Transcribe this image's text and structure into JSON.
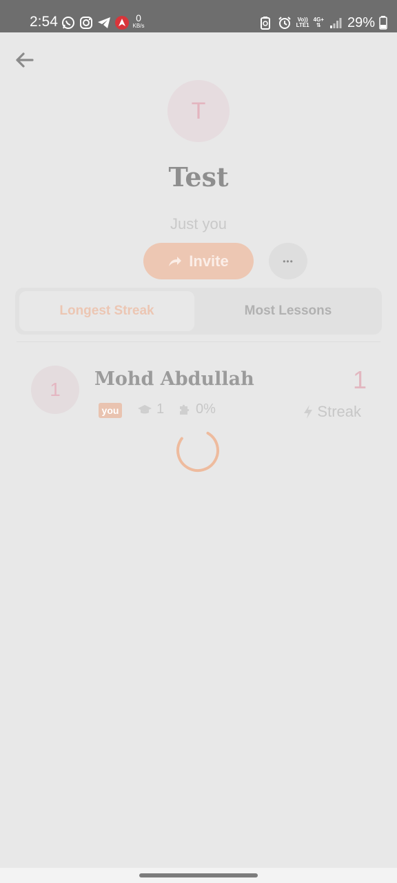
{
  "status_bar": {
    "time": "2:54",
    "net_speed_value": "0",
    "net_speed_unit": "KB/s",
    "volte_label_top": "Vo))",
    "volte_label_bottom": "LTE1",
    "signal_label_top": "4G+",
    "battery_percent": "29%",
    "left_icons": [
      "whatsapp-icon",
      "instagram-icon",
      "telegram-icon",
      "app-red-icon"
    ],
    "right_icons": [
      "recycle-icon",
      "alarm-icon",
      "signal-icon",
      "battery-icon"
    ]
  },
  "header": {
    "back_icon": "arrow-left-icon",
    "avatar_initial": "T",
    "group_name": "Test",
    "subtitle": "Just you",
    "invite_label": "Invite",
    "more_label": "•••"
  },
  "tabs": [
    {
      "label": "Longest Streak",
      "active": true
    },
    {
      "label": "Most Lessons",
      "active": false
    }
  ],
  "leaderboard": [
    {
      "rank": "1",
      "name": "Mohd Abdullah",
      "badge": "you",
      "lessons": "1",
      "progress": "0%",
      "score": "1",
      "metric_label": "Streak"
    }
  ],
  "colors": {
    "accent": "#edc7b3",
    "pink": "#e3b5bf",
    "background": "#e8e8e8",
    "status_bar": "#6e6e6e"
  }
}
